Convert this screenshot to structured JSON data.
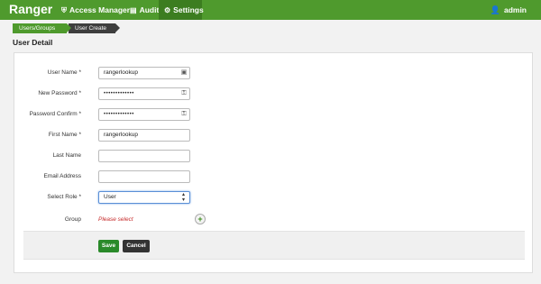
{
  "nav": {
    "brand": "Ranger",
    "items": [
      {
        "label": "Access Manager",
        "icon": "shield-icon"
      },
      {
        "label": "Audit",
        "icon": "document-icon"
      },
      {
        "label": "Settings",
        "icon": "gear-icon"
      }
    ],
    "user": "admin"
  },
  "breadcrumb": [
    "Users/Groups",
    "User Create"
  ],
  "page": {
    "title": "User Detail"
  },
  "form": {
    "user_name": {
      "label": "User Name *",
      "value": "rangerlookup"
    },
    "new_password": {
      "label": "New Password *",
      "value": "•••••••••••••"
    },
    "password_confirm": {
      "label": "Password Confirm *",
      "value": "•••••••••••••"
    },
    "first_name": {
      "label": "First Name *",
      "value": "rangerlookup"
    },
    "last_name": {
      "label": "Last Name",
      "value": ""
    },
    "email": {
      "label": "Email Address",
      "value": ""
    },
    "role": {
      "label": "Select Role *",
      "value": "User"
    },
    "group": {
      "label": "Group",
      "placeholder": "Please select"
    }
  },
  "actions": {
    "save": "Save",
    "cancel": "Cancel"
  },
  "colors": {
    "accent": "#4f9a2d",
    "save": "#2a8a2a",
    "error_text": "#c62b2b"
  }
}
